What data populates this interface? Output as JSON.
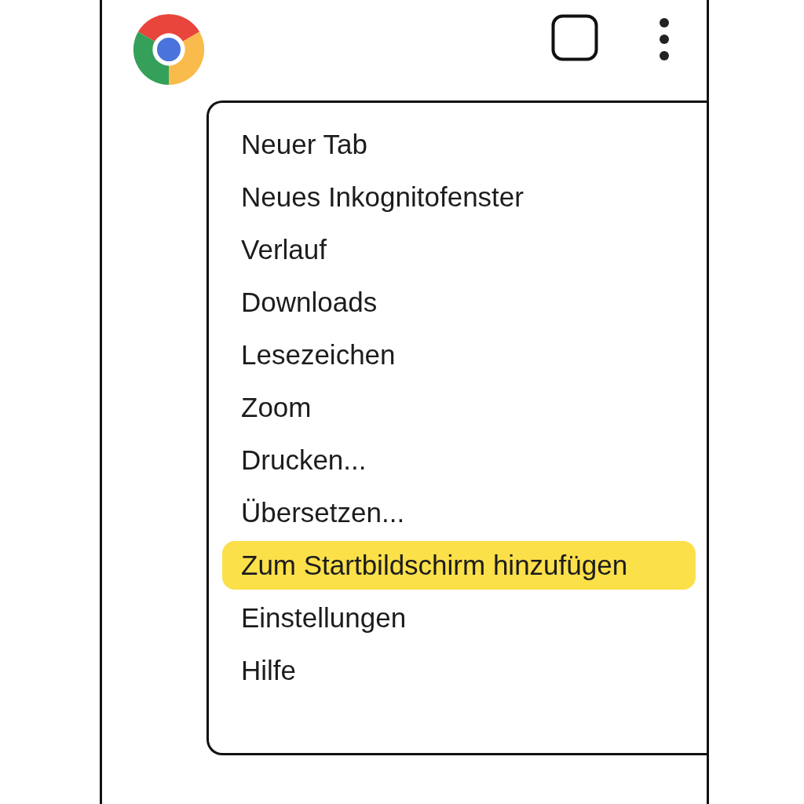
{
  "menu": {
    "items": [
      {
        "label": "Neuer Tab",
        "selected": false
      },
      {
        "label": "Neues Inkognitofenster",
        "selected": false
      },
      {
        "label": "Verlauf",
        "selected": false
      },
      {
        "label": "Downloads",
        "selected": false
      },
      {
        "label": "Lesezeichen",
        "selected": false
      },
      {
        "label": "Zoom",
        "selected": false
      },
      {
        "label": "Drucken...",
        "selected": false
      },
      {
        "label": "Übersetzen...",
        "selected": false
      },
      {
        "label": "Zum Startbildschirm hinzufügen",
        "selected": true
      },
      {
        "label": "Einstellungen",
        "selected": false
      },
      {
        "label": "Hilfe",
        "selected": false
      }
    ]
  }
}
